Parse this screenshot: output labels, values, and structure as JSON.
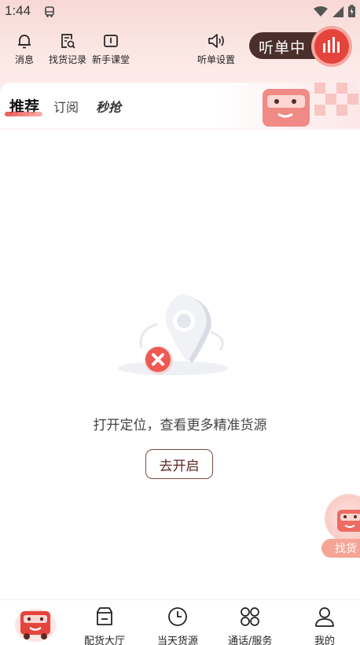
{
  "status_bar": {
    "time": "1:44"
  },
  "toolbar": {
    "messages": "消息",
    "search_history": "找货记录",
    "beginner_class": "新手课堂",
    "listen_settings": "听单设置",
    "listening": "听单中"
  },
  "tabs": [
    {
      "label": "推荐",
      "active": true
    },
    {
      "label": "订阅",
      "active": false
    },
    {
      "label": "秒抢",
      "active": false
    }
  ],
  "empty_state": {
    "message": "打开定位，查看更多精准货源",
    "button": "去开启"
  },
  "float_button": {
    "label": "找货"
  },
  "bottom_nav": [
    {
      "label": "",
      "icon": "truck-home-icon"
    },
    {
      "label": "配货大厅",
      "icon": "cargo-hall-icon"
    },
    {
      "label": "当天货源",
      "icon": "clock-icon"
    },
    {
      "label": "通话/服务",
      "icon": "grid-icon"
    },
    {
      "label": "我的",
      "icon": "user-icon"
    }
  ],
  "colors": {
    "accent": "#e5443c",
    "brand_dark": "#4a2f2a",
    "button_border": "#7a4a43"
  }
}
